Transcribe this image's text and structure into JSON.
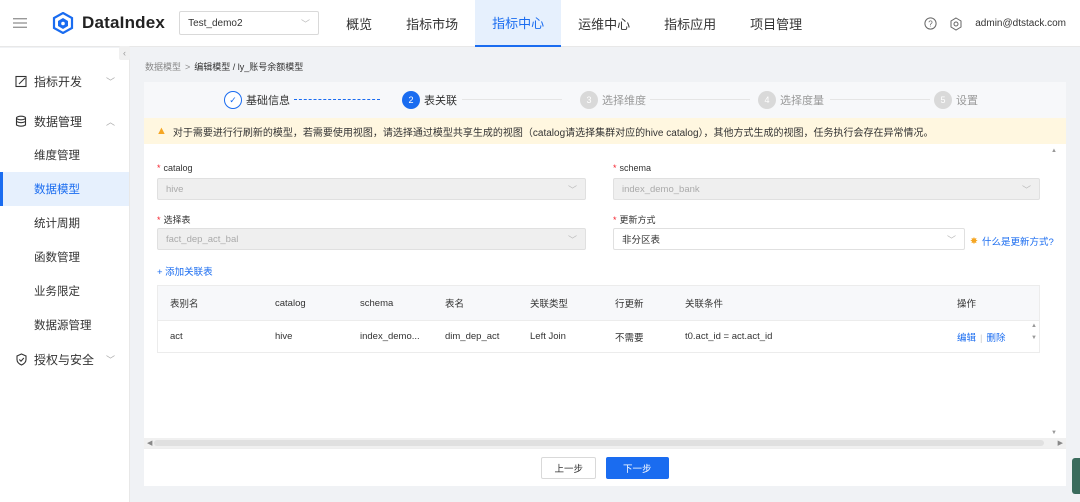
{
  "app": {
    "name": "DataIndex",
    "project": "Test_demo2",
    "user": "admin@dtstack.com"
  },
  "nav": [
    "概览",
    "指标市场",
    "指标中心",
    "运维中心",
    "指标应用",
    "项目管理"
  ],
  "sidebar": {
    "groups": [
      {
        "label": "指标开发",
        "icon": "edit-icon"
      },
      {
        "label": "数据管理",
        "icon": "database-icon"
      },
      {
        "label": "授权与安全",
        "icon": "shield-icon"
      }
    ],
    "items": [
      "维度管理",
      "数据模型",
      "统计周期",
      "函数管理",
      "业务限定",
      "数据源管理"
    ]
  },
  "breadcrumb": {
    "root": "数据模型",
    "separator": ">",
    "current": "编辑模型 / ly_账号余额模型"
  },
  "steps": [
    {
      "num": "✓",
      "label": "基础信息",
      "state": "done"
    },
    {
      "num": "2",
      "label": "表关联",
      "state": "current"
    },
    {
      "num": "3",
      "label": "选择维度",
      "state": "wait"
    },
    {
      "num": "4",
      "label": "选择度量",
      "state": "wait"
    },
    {
      "num": "5",
      "label": "设置",
      "state": "wait"
    }
  ],
  "alert": "对于需要进行行刷新的模型，若需要使用视图，请选择通过模型共享生成的视图（catalog请选择集群对应的hive catalog），其他方式生成的视图，任务执行会存在异常情况。",
  "form": {
    "catalog_label": "catalog",
    "catalog_value": "hive",
    "schema_label": "schema",
    "schema_value": "index_demo_bank",
    "table_label": "选择表",
    "table_value": "fact_dep_act_bal",
    "update_label": "更新方式",
    "update_value": "非分区表",
    "help_text": "什么是更新方式?"
  },
  "add_link": "+ 添加关联表",
  "table": {
    "headers": [
      "表别名",
      "catalog",
      "schema",
      "表名",
      "关联类型",
      "行更新",
      "关联条件",
      "操作"
    ],
    "rows": [
      {
        "alias": "act",
        "catalog": "hive",
        "schema": "index_demo...",
        "table": "dim_dep_act",
        "join": "Left Join",
        "row_update": "不需要",
        "condition": "t0.act_id = act.act_id",
        "edit": "编辑",
        "delete": "删除"
      }
    ]
  },
  "buttons": {
    "prev": "上一步",
    "next": "下一步"
  },
  "colors": {
    "accent": "#1a6cf0",
    "warning_bg": "#fff7e0",
    "warning_icon": "#f5a623"
  }
}
